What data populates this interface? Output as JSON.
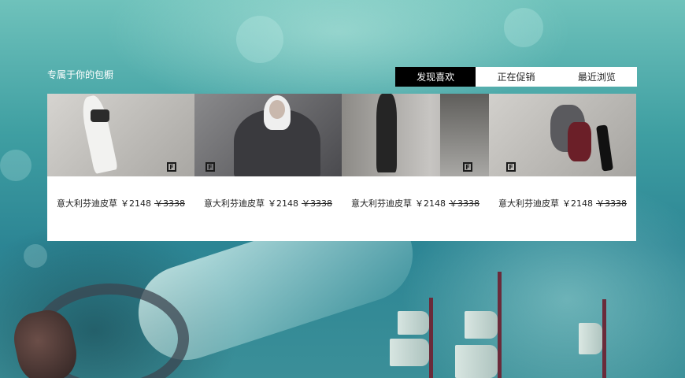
{
  "section": {
    "title": "专属于你的包橱"
  },
  "tabs": [
    {
      "label": "发现喜欢",
      "active": true
    },
    {
      "label": "正在促销",
      "active": false
    },
    {
      "label": "最近浏览",
      "active": false
    }
  ],
  "products": [
    {
      "name": "意大利芬迪皮草",
      "price": "￥2148",
      "old_price": "￥3338",
      "logo": "F"
    },
    {
      "name": "意大利芬迪皮草",
      "price": "￥2148",
      "old_price": "￥3338",
      "logo": "F"
    },
    {
      "name": "意大利芬迪皮草",
      "price": "￥2148",
      "old_price": "￥3338",
      "logo": "F"
    },
    {
      "name": "意大利芬迪皮草",
      "price": "￥2148",
      "old_price": "￥3338",
      "logo": "F"
    }
  ],
  "colors": {
    "active_tab_bg": "#000000",
    "panel_bg": "#ffffff",
    "background": "#3f9fa2"
  }
}
